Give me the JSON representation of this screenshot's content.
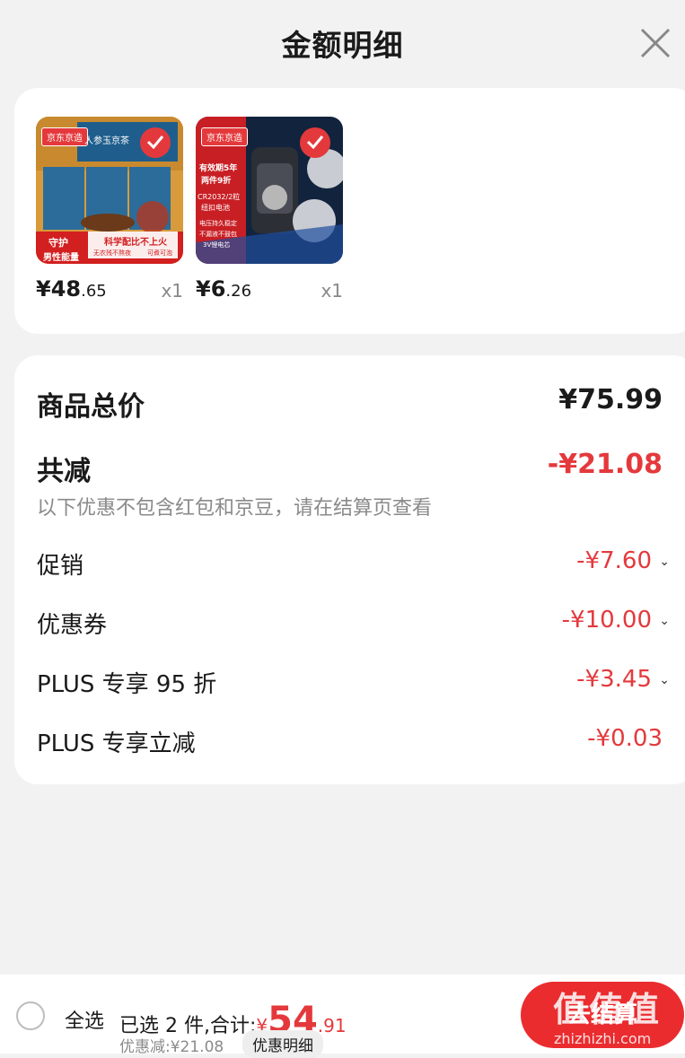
{
  "header": {
    "title": "金额明细",
    "close_icon": "close-icon"
  },
  "products": [
    {
      "price_int": "¥48",
      "price_dec": ".65",
      "qty": "x1",
      "brand": "京东京造",
      "img_text": [
        "人参玉京茶",
        "守护",
        "男性能量",
        "科学配比不上火",
        "无农残不熬夜",
        "可煮可泡"
      ]
    },
    {
      "price_int": "¥6",
      "price_dec": ".26",
      "qty": "x1",
      "brand": "京东京造",
      "img_text": [
        "有效期5年",
        "两件9折",
        "CR2032/2粒",
        "纽扣电池",
        "电压持久稳定",
        "不漏液不鼓包",
        "3V锂电芯"
      ]
    }
  ],
  "detail": {
    "total_label": "商品总价",
    "total_value": "¥75.99",
    "reduce_label": "共减",
    "reduce_value": "-¥21.08",
    "note": "以下优惠不包含红包和京豆，请在结算页查看",
    "rows": [
      {
        "label": "促销",
        "value": "-¥7.60",
        "chevron": true
      },
      {
        "label": "优惠券",
        "value": "-¥10.00",
        "chevron": true
      },
      {
        "label": "PLUS 专享 95 折",
        "value": "-¥3.45",
        "chevron": true
      },
      {
        "label": "PLUS 专享立减",
        "value": "-¥0.03",
        "chevron": false
      }
    ]
  },
  "bottom": {
    "select_all": "全选",
    "summary_prefix": "已选 2 件,合计:",
    "sum_cur": "¥",
    "sum_int": "54",
    "sum_dec": ".91",
    "discount": "优惠减:¥21.08",
    "detail_btn": "优惠明细",
    "checkout": "去结算"
  },
  "watermark": {
    "text": "值值值",
    "url": "zhizhizhi.com"
  },
  "colors": {
    "accent": "#e4393c",
    "bg": "#f2f2f2",
    "card": "#ffffff"
  }
}
